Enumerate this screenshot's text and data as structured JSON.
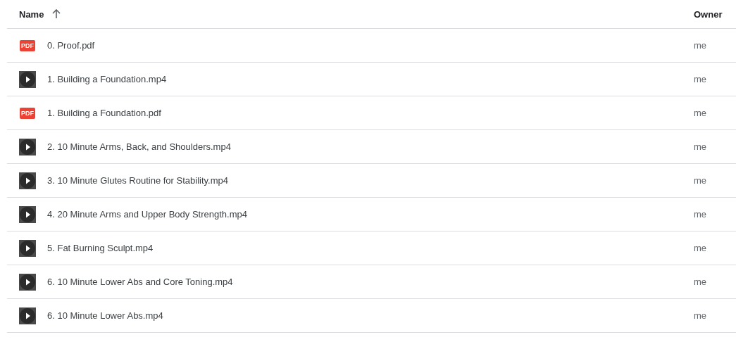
{
  "columns": [
    {
      "label": "Name",
      "sorted": true,
      "ascending": true
    },
    {
      "label": "Owner",
      "sorted": false
    }
  ],
  "files": [
    {
      "kind": "pdf",
      "badge": "PDF",
      "name": "0. Proof.pdf",
      "owner": "me"
    },
    {
      "kind": "video",
      "name": "1. Building a Foundation.mp4",
      "owner": "me"
    },
    {
      "kind": "pdf",
      "badge": "PDF",
      "name": "1. Building a Foundation.pdf",
      "owner": "me"
    },
    {
      "kind": "video",
      "name": "2. 10 Minute Arms, Back, and Shoulders.mp4",
      "owner": "me"
    },
    {
      "kind": "video",
      "name": "3. 10 Minute Glutes Routine for Stability.mp4",
      "owner": "me"
    },
    {
      "kind": "video",
      "name": "4. 20 Minute Arms and Upper Body Strength.mp4",
      "owner": "me"
    },
    {
      "kind": "video",
      "name": "5. Fat Burning Sculpt.mp4",
      "owner": "me"
    },
    {
      "kind": "video",
      "name": "6. 10 Minute Lower Abs and Core Toning.mp4",
      "owner": "me"
    },
    {
      "kind": "video",
      "name": "6. 10 Minute Lower Abs.mp4",
      "owner": "me"
    }
  ]
}
